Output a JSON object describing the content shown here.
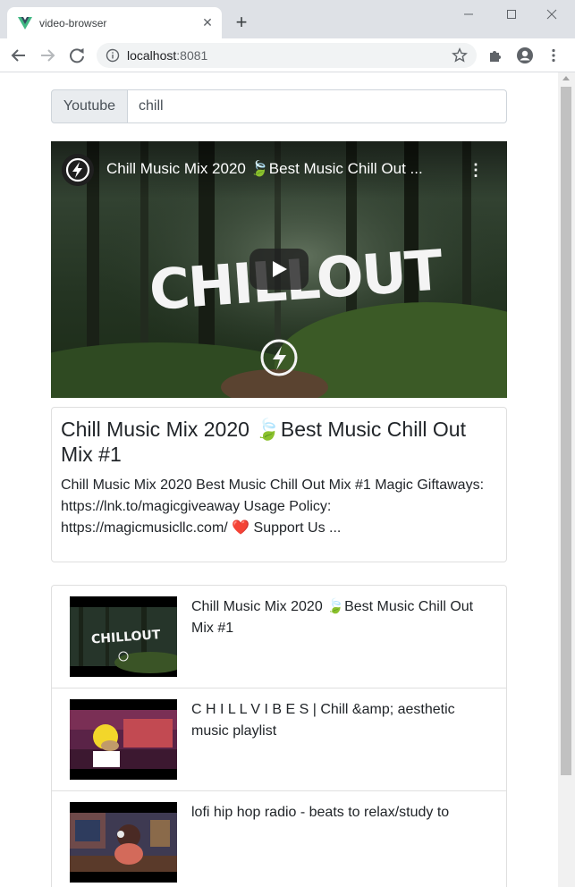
{
  "browser": {
    "tab_title": "video-browser",
    "tab_close_glyph": "✕",
    "new_tab_glyph": "+",
    "url": "localhost",
    "url_port": ":8081"
  },
  "search": {
    "prefix": "Youtube",
    "value": "chill"
  },
  "player": {
    "title": "Chill Music Mix 2020 🍃Best Music Chill Out ...",
    "menu_glyph": "⋮",
    "thumbnail_text": "CHILLOUT"
  },
  "detail": {
    "title": "Chill Music Mix 2020 🍃Best Music Chill Out Mix #1",
    "description": "Chill Music Mix 2020 Best Music Chill Out Mix #1 Magic Giftaways: https://lnk.to/magicgiveaway Usage Policy: https://magicmusicllc.com/ ❤️ Support Us ..."
  },
  "video_list": [
    {
      "title": "Chill Music Mix 2020 🍃Best Music Chill Out Mix #1",
      "thumb_text": "CHILLOUT"
    },
    {
      "title": "C H I L L V I B E S | Chill &amp; aesthetic music playlist",
      "thumb_text": ""
    },
    {
      "title": "lofi hip hop radio - beats to relax/study to",
      "thumb_text": ""
    }
  ],
  "colors": {
    "accent_vue_green": "#41b883",
    "border": "#dfdfdf",
    "prefix_bg": "#e9ecef",
    "text": "#212529"
  }
}
